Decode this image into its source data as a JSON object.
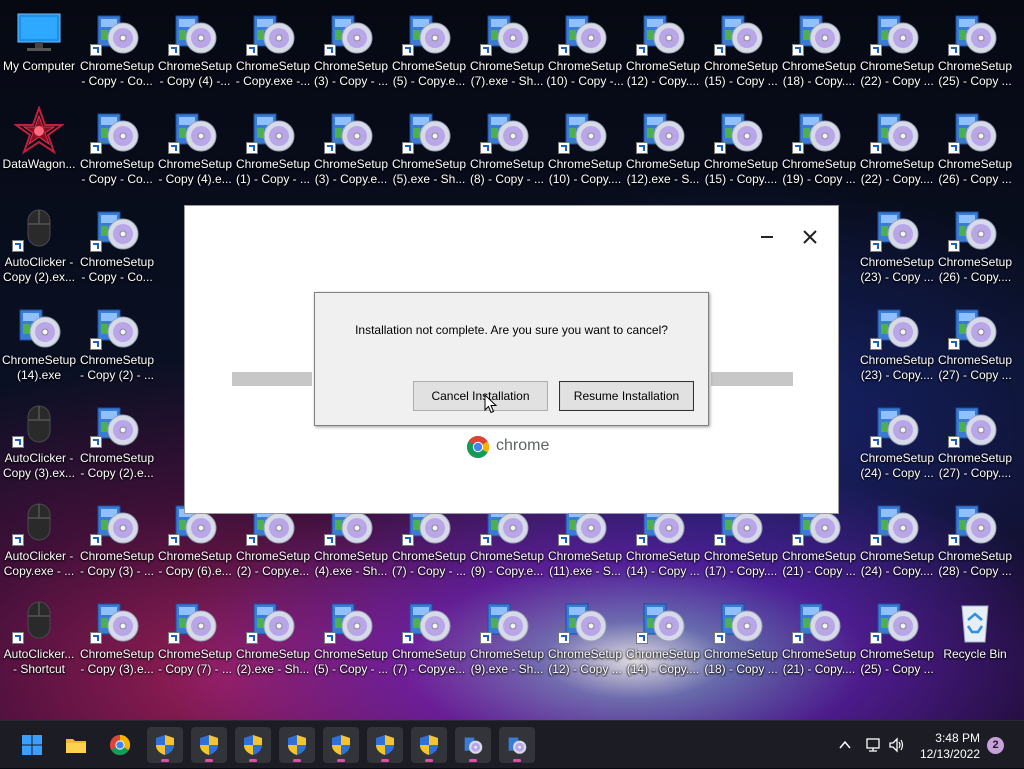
{
  "desktop": {
    "icons": [
      {
        "label": "My Computer",
        "type": "computer",
        "shortcut": false
      },
      {
        "label": "ChromeSetup\n- Copy - Co...",
        "type": "setup",
        "shortcut": true
      },
      {
        "label": "ChromeSetup\n- Copy (4) -...",
        "type": "setup",
        "shortcut": true
      },
      {
        "label": "ChromeSetup\n- Copy.exe -...",
        "type": "setup",
        "shortcut": true
      },
      {
        "label": "ChromeSetup\n(3) - Copy - ...",
        "type": "setup",
        "shortcut": true
      },
      {
        "label": "ChromeSetup\n(5) - Copy.e...",
        "type": "setup",
        "shortcut": true
      },
      {
        "label": "ChromeSetup\n(7).exe - Sh...",
        "type": "setup",
        "shortcut": true
      },
      {
        "label": "ChromeSetup\n(10) - Copy -...",
        "type": "setup",
        "shortcut": true
      },
      {
        "label": "ChromeSetup\n(12) - Copy....",
        "type": "setup",
        "shortcut": true
      },
      {
        "label": "ChromeSetup\n(15) - Copy ...",
        "type": "setup",
        "shortcut": true
      },
      {
        "label": "ChromeSetup\n(18) - Copy....",
        "type": "setup",
        "shortcut": true
      },
      {
        "label": "ChromeSetup\n(22) - Copy ...",
        "type": "setup",
        "shortcut": true
      },
      {
        "label": "ChromeSetup\n(25) - Copy ...",
        "type": "setup",
        "shortcut": true
      },
      {
        "label": "DataWagon...",
        "type": "datawagon",
        "shortcut": false
      },
      {
        "label": "ChromeSetup\n- Copy - Co...",
        "type": "setup",
        "shortcut": true
      },
      {
        "label": "ChromeSetup\n- Copy (4).e...",
        "type": "setup",
        "shortcut": true
      },
      {
        "label": "ChromeSetup\n(1) - Copy - ...",
        "type": "setup",
        "shortcut": true
      },
      {
        "label": "ChromeSetup\n(3) - Copy.e...",
        "type": "setup",
        "shortcut": true
      },
      {
        "label": "ChromeSetup\n(5).exe - Sh...",
        "type": "setup",
        "shortcut": true
      },
      {
        "label": "ChromeSetup\n(8) - Copy - ...",
        "type": "setup",
        "shortcut": true
      },
      {
        "label": "ChromeSetup\n(10) - Copy....",
        "type": "setup",
        "shortcut": true
      },
      {
        "label": "ChromeSetup\n(12).exe - S...",
        "type": "setup",
        "shortcut": true
      },
      {
        "label": "ChromeSetup\n(15) - Copy....",
        "type": "setup",
        "shortcut": true
      },
      {
        "label": "ChromeSetup\n(19) - Copy ...",
        "type": "setup",
        "shortcut": true
      },
      {
        "label": "ChromeSetup\n(22) - Copy....",
        "type": "setup",
        "shortcut": true
      },
      {
        "label": "ChromeSetup\n(26) - Copy ...",
        "type": "setup",
        "shortcut": true
      },
      {
        "label": "AutoClicker -\nCopy (2).ex...",
        "type": "mouse",
        "shortcut": true
      },
      {
        "label": "ChromeSetup\n- Copy - Co...",
        "type": "setup",
        "shortcut": true
      },
      {
        "label": "ChromeSetup\n(23) - Copy ...",
        "type": "setup",
        "shortcut": true
      },
      {
        "label": "ChromeSetup\n(26) - Copy....",
        "type": "setup",
        "shortcut": true
      },
      {
        "label": "ChromeSetup\n(14).exe",
        "type": "setup",
        "shortcut": false
      },
      {
        "label": "ChromeSetup\n- Copy (2) - ...",
        "type": "setup",
        "shortcut": true
      },
      {
        "label": "ChromeSetup\n(23) - Copy....",
        "type": "setup",
        "shortcut": true
      },
      {
        "label": "ChromeSetup\n(27) - Copy ...",
        "type": "setup",
        "shortcut": true
      },
      {
        "label": "AutoClicker -\nCopy (3).ex...",
        "type": "mouse",
        "shortcut": true
      },
      {
        "label": "ChromeSetup\n- Copy (2).e...",
        "type": "setup",
        "shortcut": true
      },
      {
        "label": "ChromeSetup\n(24) - Copy ...",
        "type": "setup",
        "shortcut": true
      },
      {
        "label": "ChromeSetup\n(27) - Copy....",
        "type": "setup",
        "shortcut": true
      },
      {
        "label": "AutoClicker -\nCopy.exe - ...",
        "type": "mouse",
        "shortcut": true
      },
      {
        "label": "ChromeSetup\n- Copy (3) - ...",
        "type": "setup",
        "shortcut": true
      },
      {
        "label": "ChromeSetup\n- Copy (6).e...",
        "type": "setup",
        "shortcut": true
      },
      {
        "label": "ChromeSetup\n(2) - Copy.e...",
        "type": "setup",
        "shortcut": true
      },
      {
        "label": "ChromeSetup\n(4).exe - Sh...",
        "type": "setup",
        "shortcut": true
      },
      {
        "label": "ChromeSetup\n(7) - Copy - ...",
        "type": "setup",
        "shortcut": true
      },
      {
        "label": "ChromeSetup\n(9) - Copy.e...",
        "type": "setup",
        "shortcut": true
      },
      {
        "label": "ChromeSetup\n(11).exe - S...",
        "type": "setup",
        "shortcut": true
      },
      {
        "label": "ChromeSetup\n(14) - Copy ...",
        "type": "setup",
        "shortcut": true
      },
      {
        "label": "ChromeSetup\n(17) - Copy....",
        "type": "setup",
        "shortcut": true
      },
      {
        "label": "ChromeSetup\n(21) - Copy ...",
        "type": "setup",
        "shortcut": true
      },
      {
        "label": "ChromeSetup\n(24) - Copy....",
        "type": "setup",
        "shortcut": true
      },
      {
        "label": "ChromeSetup\n(28) - Copy ...",
        "type": "setup",
        "shortcut": true
      },
      {
        "label": "AutoClicker...\n- Shortcut",
        "type": "mouse",
        "shortcut": true
      },
      {
        "label": "ChromeSetup\n- Copy (3).e...",
        "type": "setup",
        "shortcut": true
      },
      {
        "label": "ChromeSetup\n- Copy (7) - ...",
        "type": "setup",
        "shortcut": true
      },
      {
        "label": "ChromeSetup\n(2).exe - Sh...",
        "type": "setup",
        "shortcut": true
      },
      {
        "label": "ChromeSetup\n(5) - Copy - ...",
        "type": "setup",
        "shortcut": true
      },
      {
        "label": "ChromeSetup\n(7) - Copy.e...",
        "type": "setup",
        "shortcut": true
      },
      {
        "label": "ChromeSetup\n(9).exe - Sh...",
        "type": "setup",
        "shortcut": true
      },
      {
        "label": "ChromeSetup\n(12) - Copy ...",
        "type": "setup",
        "shortcut": true
      },
      {
        "label": "ChromeSetup\n(14) - Copy....",
        "type": "setup",
        "shortcut": true
      },
      {
        "label": "ChromeSetup\n(18) - Copy ...",
        "type": "setup",
        "shortcut": true
      },
      {
        "label": "ChromeSetup\n(21) - Copy....",
        "type": "setup",
        "shortcut": true
      },
      {
        "label": "ChromeSetup\n(25) - Copy ...",
        "type": "setup",
        "shortcut": true
      },
      {
        "label": "Recycle Bin",
        "type": "recycle",
        "shortcut": false
      }
    ]
  },
  "installer": {
    "brand": "chrome",
    "confirm_dialog": {
      "message": "Installation not complete. Are you sure you want to cancel?",
      "cancel_label": "Cancel Installation",
      "resume_label": "Resume Installation"
    }
  },
  "taskbar": {
    "apps": [
      {
        "name": "start-button",
        "icon": "windows-logo-icon",
        "active": false
      },
      {
        "name": "file-explorer",
        "icon": "folder-icon",
        "active": false
      },
      {
        "name": "chrome",
        "icon": "chrome-icon",
        "active": false
      },
      {
        "name": "installer-1",
        "icon": "shield-icon",
        "active": true
      },
      {
        "name": "installer-2",
        "icon": "shield-icon",
        "active": true
      },
      {
        "name": "installer-3",
        "icon": "shield-icon",
        "active": true
      },
      {
        "name": "installer-4",
        "icon": "shield-icon",
        "active": true
      },
      {
        "name": "installer-5",
        "icon": "shield-icon",
        "active": true
      },
      {
        "name": "installer-6",
        "icon": "shield-icon",
        "active": true
      },
      {
        "name": "installer-7",
        "icon": "shield-icon",
        "active": true
      },
      {
        "name": "setup-app-1",
        "icon": "setup-icon",
        "active": true
      },
      {
        "name": "setup-app-2",
        "icon": "setup-icon",
        "active": true
      }
    ],
    "time": "3:48 PM",
    "date": "12/13/2022",
    "notification_count": "2"
  },
  "colors": {
    "taskbar_indicator": "#e04ea8",
    "notification_badge": "#c9a0dc"
  }
}
